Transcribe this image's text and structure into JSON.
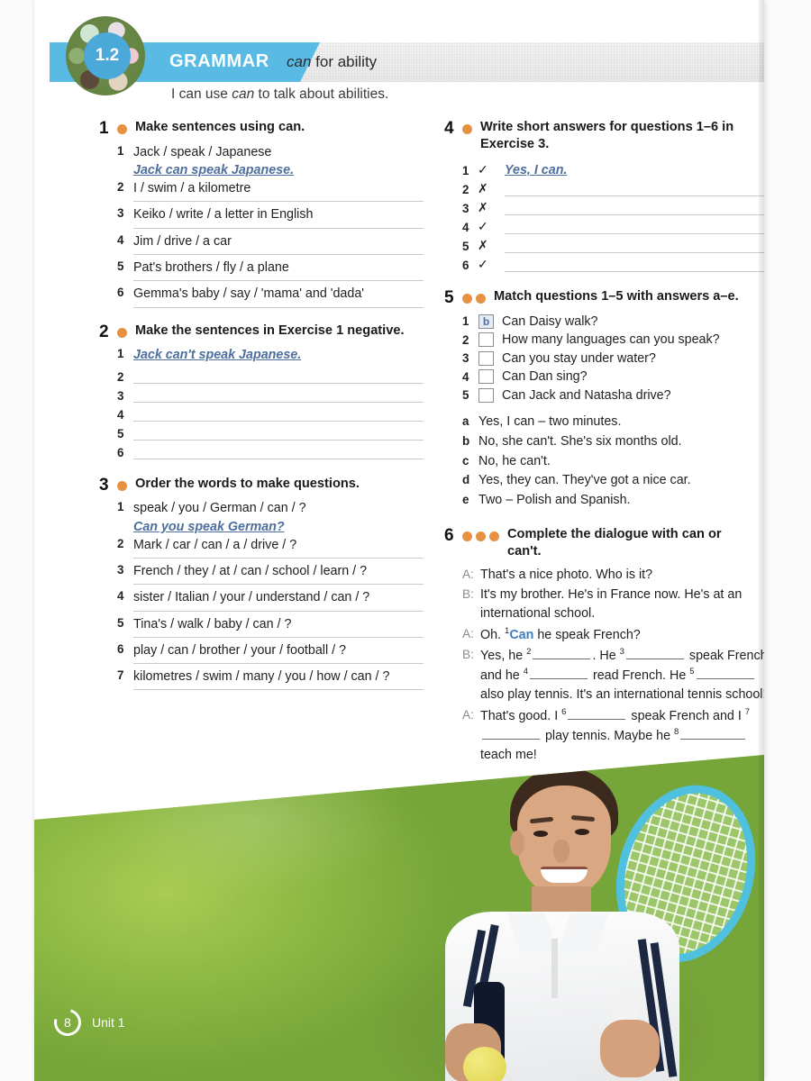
{
  "header": {
    "unit_badge": "1.2",
    "section_label": "GRAMMAR",
    "topic_italic": "can",
    "topic_rest": " for ability",
    "cando_pre": "I can use ",
    "cando_italic": "can",
    "cando_post": " to talk about abilities.",
    "accent_blue": "#59bbe3",
    "accent_orange": "#e79243",
    "answer_blue": "#4e6f9e"
  },
  "exercises": {
    "ex1": {
      "number": "1",
      "dots": 1,
      "title": "Make sentences using can.",
      "items": [
        {
          "idx": "1",
          "prompt": "Jack / speak / Japanese",
          "answer": "Jack can speak Japanese.",
          "rule": false
        },
        {
          "idx": "2",
          "prompt": "I / swim / a kilometre",
          "answer": "",
          "rule": true
        },
        {
          "idx": "3",
          "prompt": "Keiko / write / a letter in English",
          "answer": "",
          "rule": true
        },
        {
          "idx": "4",
          "prompt": "Jim / drive / a car",
          "answer": "",
          "rule": true
        },
        {
          "idx": "5",
          "prompt": "Pat's brothers / fly / a plane",
          "answer": "",
          "rule": true
        },
        {
          "idx": "6",
          "prompt": "Gemma's baby / say / 'mama' and 'dada'",
          "answer": "",
          "rule": true
        }
      ]
    },
    "ex2": {
      "number": "2",
      "dots": 1,
      "title": "Make the sentences in Exercise 1 negative.",
      "first_idx": "1",
      "first_answer": "Jack can't speak Japanese.",
      "blank_idxs": [
        "2",
        "3",
        "4",
        "5",
        "6"
      ]
    },
    "ex3": {
      "number": "3",
      "dots": 1,
      "title": "Order the words to make questions.",
      "items": [
        {
          "idx": "1",
          "prompt": "speak / you / German / can / ?",
          "answer": "Can you speak German?",
          "rule": false
        },
        {
          "idx": "2",
          "prompt": "Mark / car / can / a / drive / ?",
          "answer": "",
          "rule": true
        },
        {
          "idx": "3",
          "prompt": "French / they / at / can / school / learn / ?",
          "answer": "",
          "rule": true
        },
        {
          "idx": "4",
          "prompt": "sister / Italian / your / understand / can / ?",
          "answer": "",
          "rule": true
        },
        {
          "idx": "5",
          "prompt": "Tina's / walk / baby / can / ?",
          "answer": "",
          "rule": true
        },
        {
          "idx": "6",
          "prompt": "play / can / brother / your / football / ?",
          "answer": "",
          "rule": true
        },
        {
          "idx": "7",
          "prompt": "kilometres / swim / many / you / how / can / ?",
          "answer": "",
          "rule": true
        }
      ]
    },
    "ex4": {
      "number": "4",
      "dots": 1,
      "title": "Write short answers for questions 1–6 in Exercise 3.",
      "rows": [
        {
          "idx": "1",
          "mark": "✓",
          "answer": "Yes, I can."
        },
        {
          "idx": "2",
          "mark": "✗",
          "answer": ""
        },
        {
          "idx": "3",
          "mark": "✗",
          "answer": ""
        },
        {
          "idx": "4",
          "mark": "✓",
          "answer": ""
        },
        {
          "idx": "5",
          "mark": "✗",
          "answer": ""
        },
        {
          "idx": "6",
          "mark": "✓",
          "answer": ""
        }
      ]
    },
    "ex5": {
      "number": "5",
      "dots": 2,
      "title": "Match questions 1–5 with answers a–e.",
      "questions": [
        {
          "idx": "1",
          "box": "b",
          "text": "Can Daisy walk?"
        },
        {
          "idx": "2",
          "box": "",
          "text": "How many languages can you speak?"
        },
        {
          "idx": "3",
          "box": "",
          "text": "Can you stay under water?"
        },
        {
          "idx": "4",
          "box": "",
          "text": "Can Dan sing?"
        },
        {
          "idx": "5",
          "box": "",
          "text": "Can Jack and Natasha drive?"
        }
      ],
      "answers": [
        {
          "let": "a",
          "text": "Yes, I can – two minutes."
        },
        {
          "let": "b",
          "text": "No, she can't. She's six months old."
        },
        {
          "let": "c",
          "text": "No, he can't."
        },
        {
          "let": "d",
          "text": "Yes, they can. They've got a nice car."
        },
        {
          "let": "e",
          "text": "Two – Polish and Spanish."
        }
      ]
    },
    "ex6": {
      "number": "6",
      "dots": 3,
      "title": "Complete the dialogue with can or can't.",
      "lines": [
        {
          "speaker": "A:",
          "text": "That's a nice photo. Who is it?"
        },
        {
          "speaker": "B:",
          "text": "It's my brother. He's in France now. He's at an international school."
        },
        {
          "speaker": "A:",
          "text": "Oh. ¹Can he speak French?"
        },
        {
          "speaker": "B:",
          "text": "Yes, he ² ____ . He ³ ____ speak French and he ⁴ ____ read French. He ⁵ ____ also play tennis. It's an international tennis school!"
        },
        {
          "speaker": "A:",
          "text": "That's good. I ⁶ ____ speak French and I ⁷ ____ play tennis. Maybe he ⁸ ____ teach me!"
        }
      ],
      "filled_answer": "Can"
    }
  },
  "footer": {
    "page_number": "8",
    "unit_label": "Unit 1"
  }
}
